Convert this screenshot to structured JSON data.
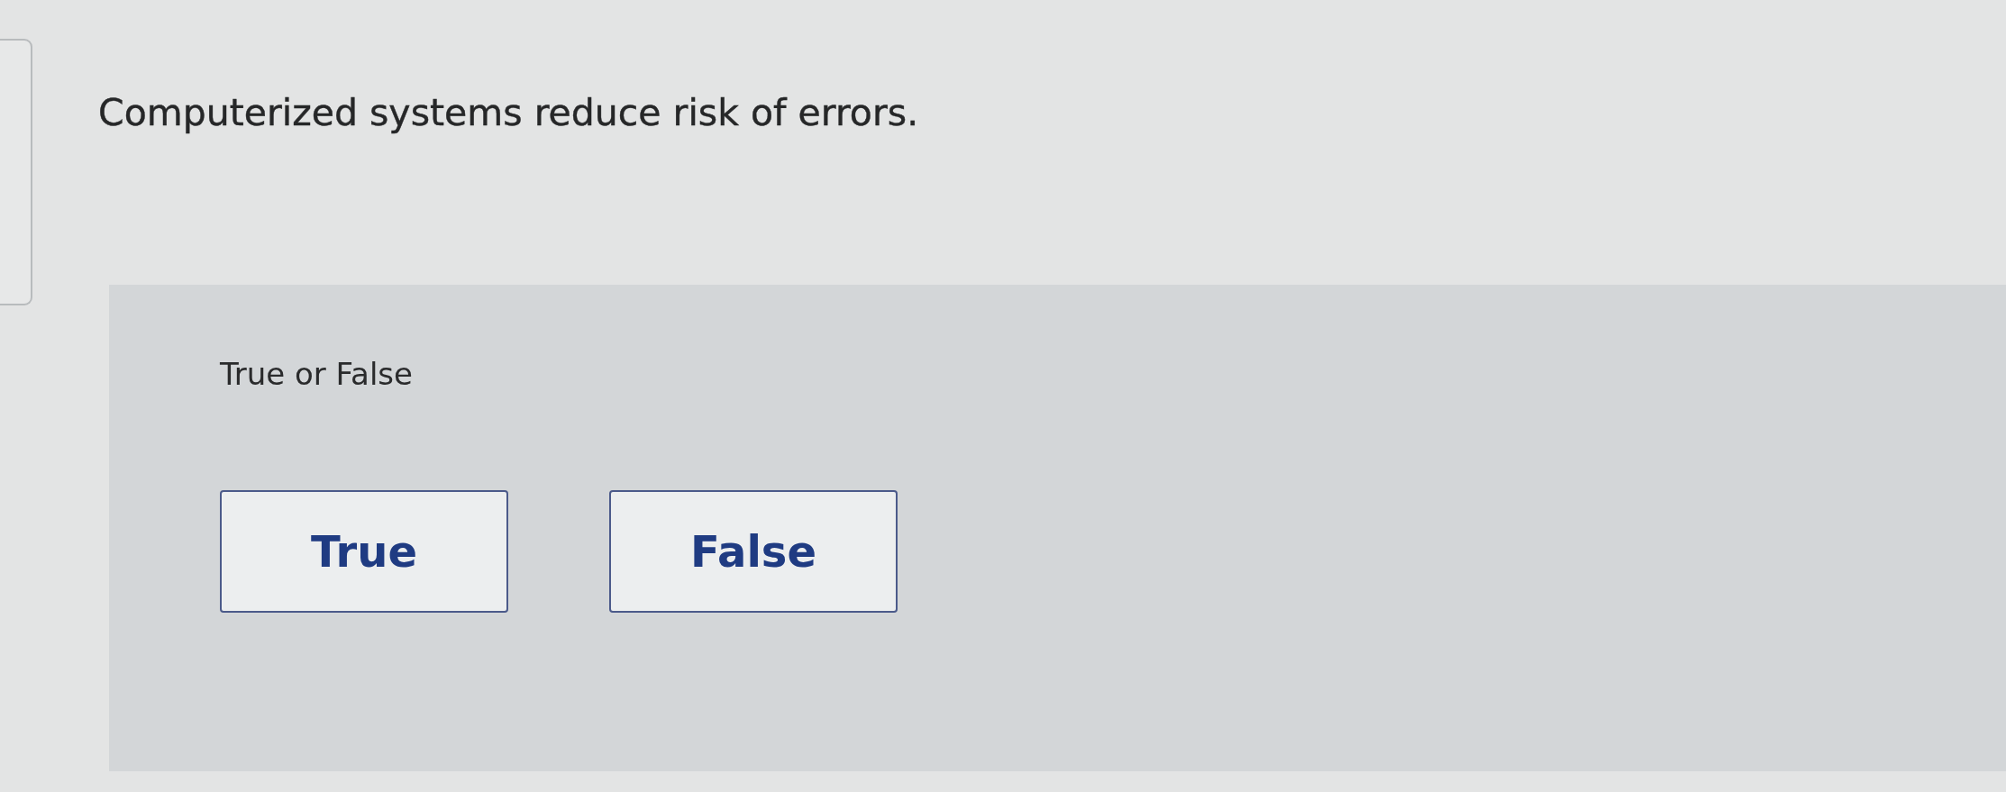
{
  "question": {
    "text": "Computerized systems reduce risk of errors."
  },
  "answer_area": {
    "prompt": "True or False",
    "options": [
      {
        "label": "True",
        "selected": false
      },
      {
        "label": "False",
        "selected": false
      }
    ]
  }
}
